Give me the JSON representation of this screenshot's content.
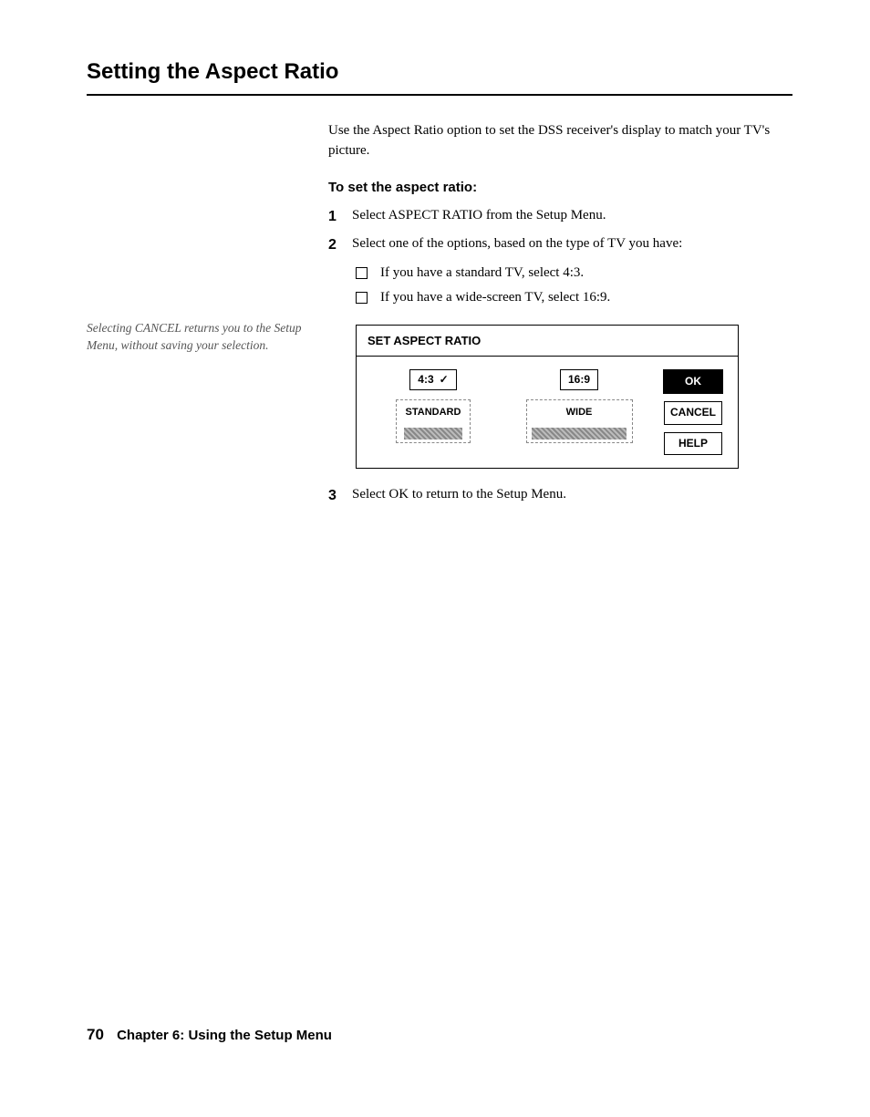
{
  "title": "Setting the Aspect Ratio",
  "intro": "Use the Aspect Ratio option to set the DSS receiver's display to match your TV's picture.",
  "subhead": "To set the aspect ratio:",
  "side_note": "Selecting CANCEL returns you to the Setup Menu, without saving your selection.",
  "steps": {
    "s1": {
      "num": "1",
      "text": "Select ASPECT RATIO from the Setup Menu."
    },
    "s2": {
      "num": "2",
      "text": "Select one of the options, based on the type of TV you have:"
    },
    "s3": {
      "num": "3",
      "text": "Select OK to return to the Setup Menu."
    }
  },
  "bullets": {
    "b1": "If you have a standard TV, select 4:3.",
    "b2": "If you have a wide-screen TV, select 16:9."
  },
  "diagram": {
    "title": "SET ASPECT RATIO",
    "opt43": "4:3",
    "opt169": "16:9",
    "standard": "STANDARD",
    "wide": "WIDE",
    "ok": "OK",
    "cancel": "CANCEL",
    "help": "HELP"
  },
  "footer": {
    "page": "70",
    "chapter": "Chapter 6: Using the Setup Menu"
  }
}
